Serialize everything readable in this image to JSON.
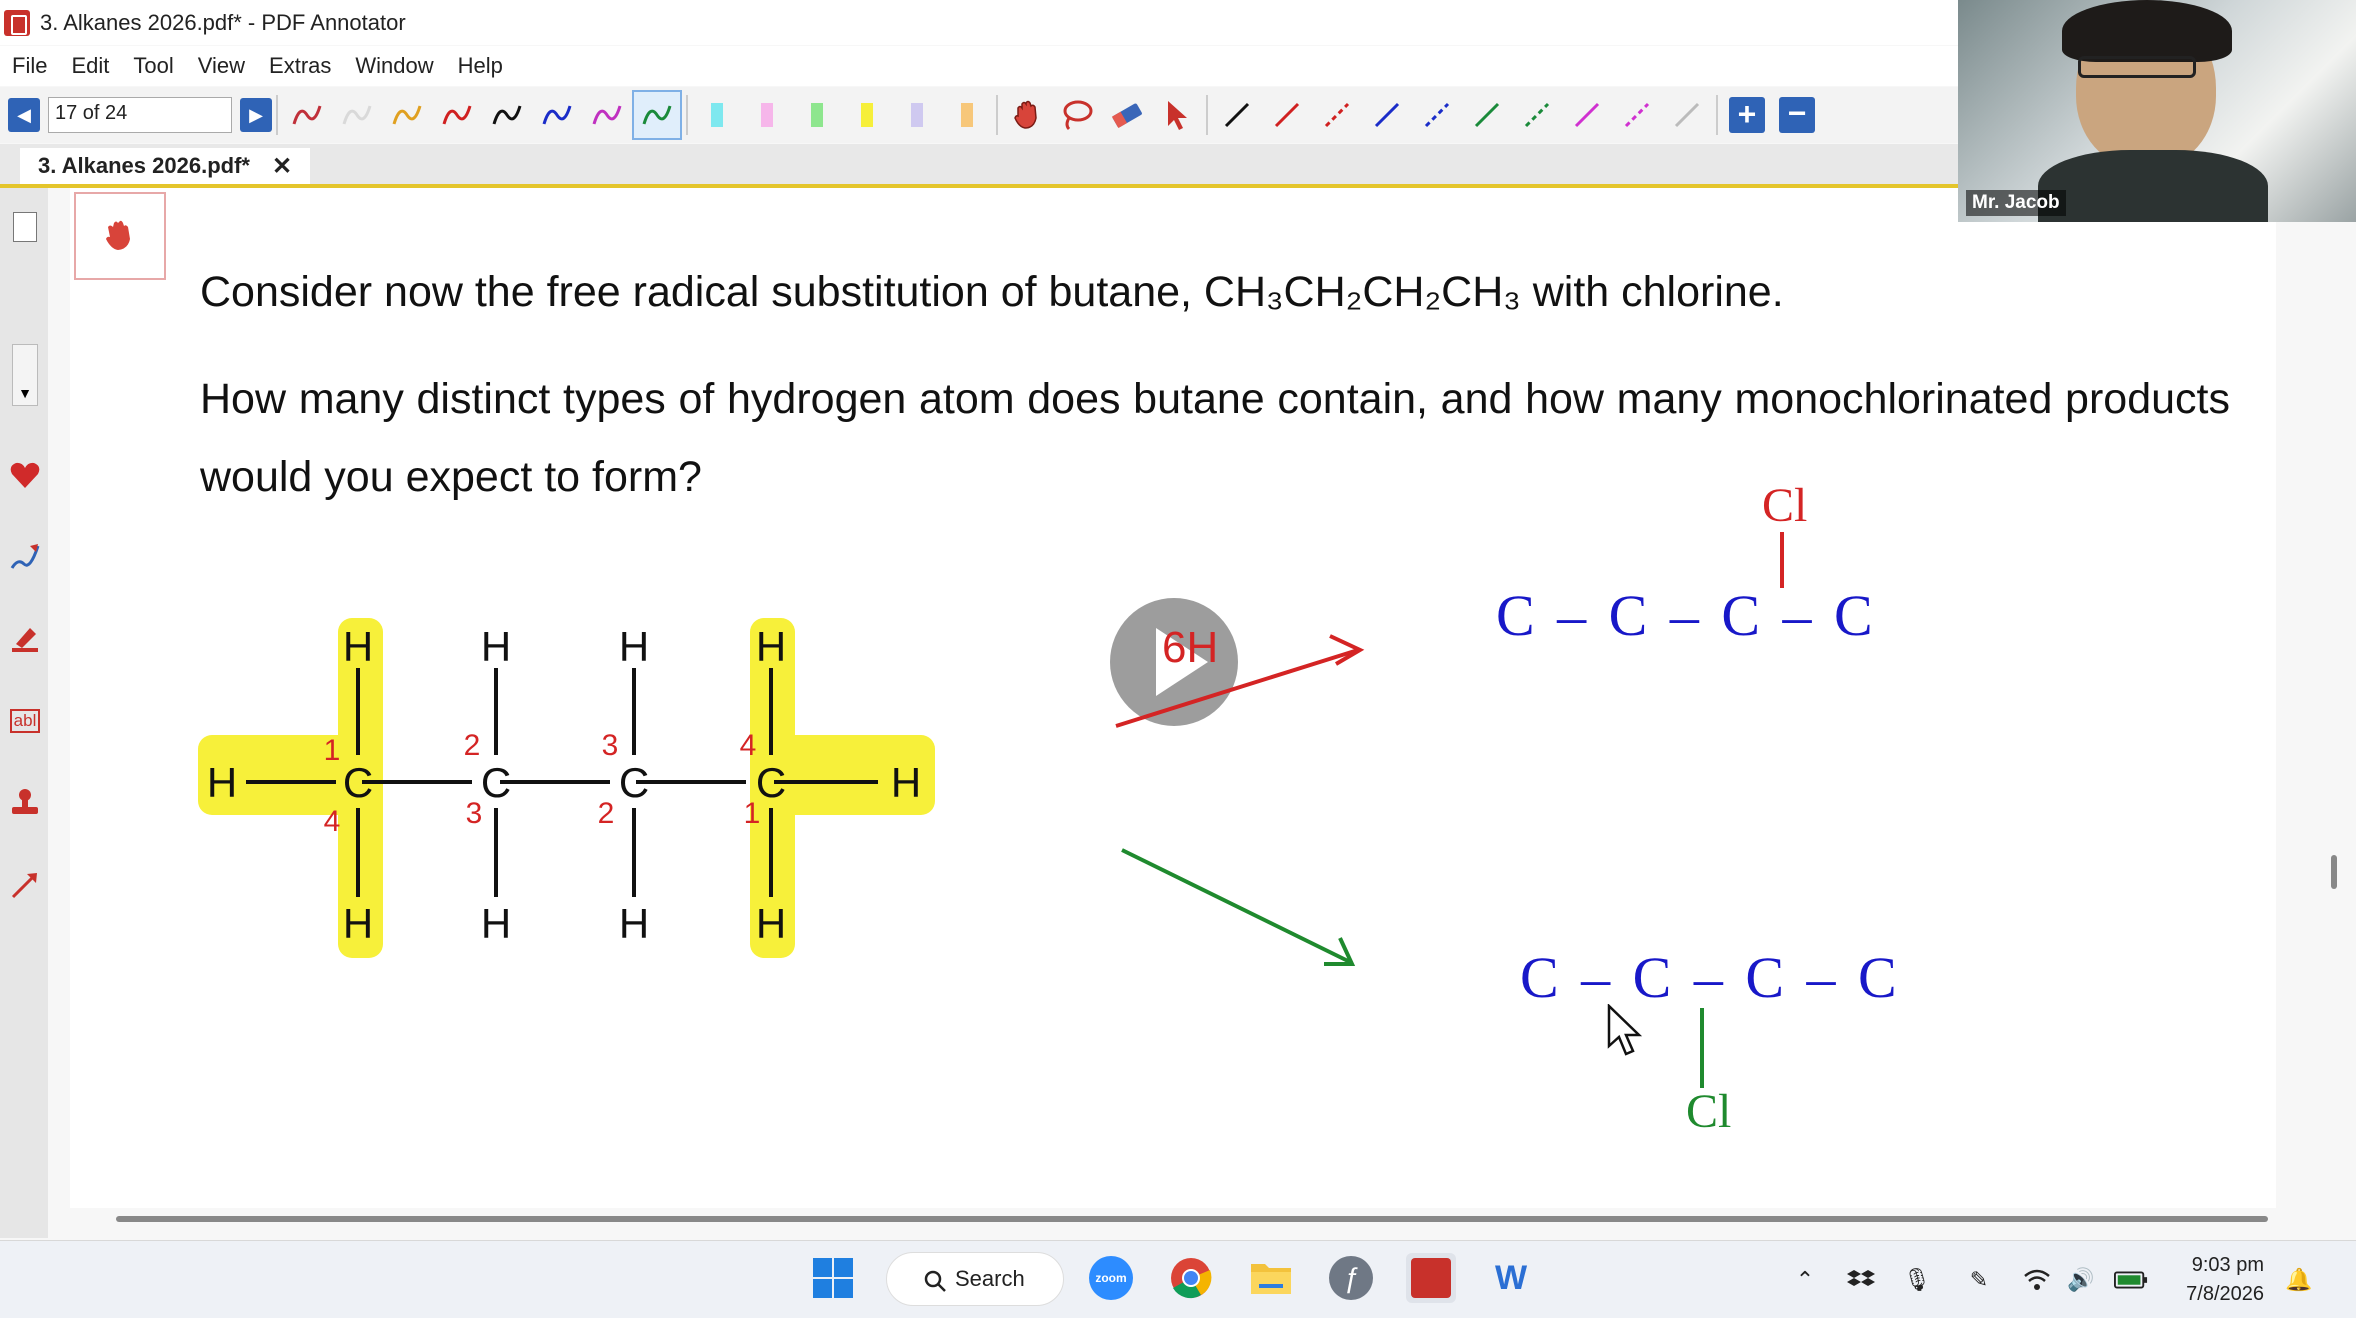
{
  "window": {
    "title": "3. Alkanes 2026.pdf* - PDF Annotator",
    "menu": [
      "File",
      "Edit",
      "Tool",
      "View",
      "Extras",
      "Window",
      "Help"
    ]
  },
  "toolbar": {
    "page_indicator": "17 of 24",
    "pen_colors": [
      "#c0303a",
      "#d9d9d9",
      "#e0a020",
      "#d02020",
      "#111111",
      "#1a2cc8",
      "#c030c0",
      "#1a8a3a"
    ],
    "highlighter_colors": [
      "#7ee8ef",
      "#f6b6ea",
      "#8ee68e",
      "#f6ef3a",
      "#cfc9f0",
      "#f7c77a"
    ],
    "line_colors": [
      "#111111",
      "#d02020",
      "#d02020",
      "#1a2cc8",
      "#1a2cc8",
      "#1a8a3a",
      "#1a8a3a",
      "#d030d0",
      "#d030d0",
      "#bbbbbb"
    ],
    "icons": [
      "prev-page-icon",
      "next-page-icon",
      "hand-icon",
      "lasso-icon",
      "eraser-icon",
      "select-arrow-icon",
      "zoom-in-icon",
      "zoom-out-icon"
    ]
  },
  "tab": {
    "label": "3. Alkanes 2026.pdf*",
    "close": "✕"
  },
  "document": {
    "question_line1": "Consider now the free radical substitution of butane, CH₃CH₂CH₂CH₃ with chlorine.",
    "question_line2": "How many distinct types of hydrogen atom does butane contain, and how many monochlorinated products would you expect to form?",
    "carbon_label": "C",
    "hydrogen_label": "H",
    "carbon_numbers_top": [
      "1",
      "2",
      "3",
      "4"
    ],
    "carbon_numbers_bottom": [
      "4",
      "3",
      "2",
      "1"
    ],
    "note_6h": "6H",
    "product1_chain": "C – C – C – C",
    "product1_substituent": "Cl",
    "product2_chain": "C – C – C – C",
    "product2_substituent": "Cl",
    "highlight_color": "#f7f03a",
    "annotation_red": "#d42424",
    "annotation_blue": "#1818c8",
    "annotation_green": "#1f8a2e"
  },
  "webcam": {
    "name": "Mr. Jacob"
  },
  "taskbar": {
    "search_label": "Search",
    "time": "9:03 pm",
    "date": "7/8/2026",
    "apps": [
      "windows-start-icon",
      "zoom-icon",
      "chrome-icon",
      "file-explorer-icon",
      "app-icon",
      "pdf-annotator-icon",
      "word-icon"
    ],
    "tray_icons": [
      "chevron-up-icon",
      "dropbox-icon",
      "microphone-icon",
      "pen-icon",
      "wifi-icon",
      "volume-icon",
      "battery-icon",
      "notification-icon"
    ]
  }
}
